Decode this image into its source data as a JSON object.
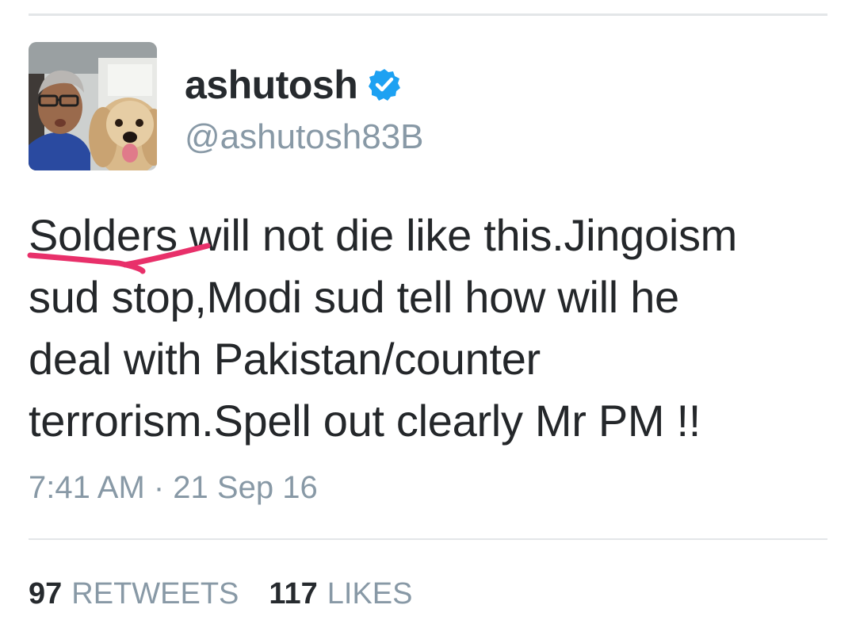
{
  "author": {
    "display_name": "ashutosh",
    "handle": "@ashutosh83B",
    "verified_icon": "verified-badge-icon",
    "avatar_icon": "profile-photo"
  },
  "tweet": {
    "text": "Solders will not die like this.Jingoism\nsud stop,Modi sud tell how will he\ndeal with Pakistan/counter\nterrorism.Spell out clearly Mr PM !!",
    "annotation_color": "#e8306a",
    "timestamp": "7:41 AM · 21 Sep 16"
  },
  "stats": {
    "retweets_count": "97",
    "retweets_label": "RETWEETS",
    "likes_count": "117",
    "likes_label": "LIKES"
  },
  "colors": {
    "text_primary": "#24272a",
    "text_secondary": "#8899a6",
    "verified_blue": "#1da1f2",
    "divider": "#e3e6e8"
  }
}
